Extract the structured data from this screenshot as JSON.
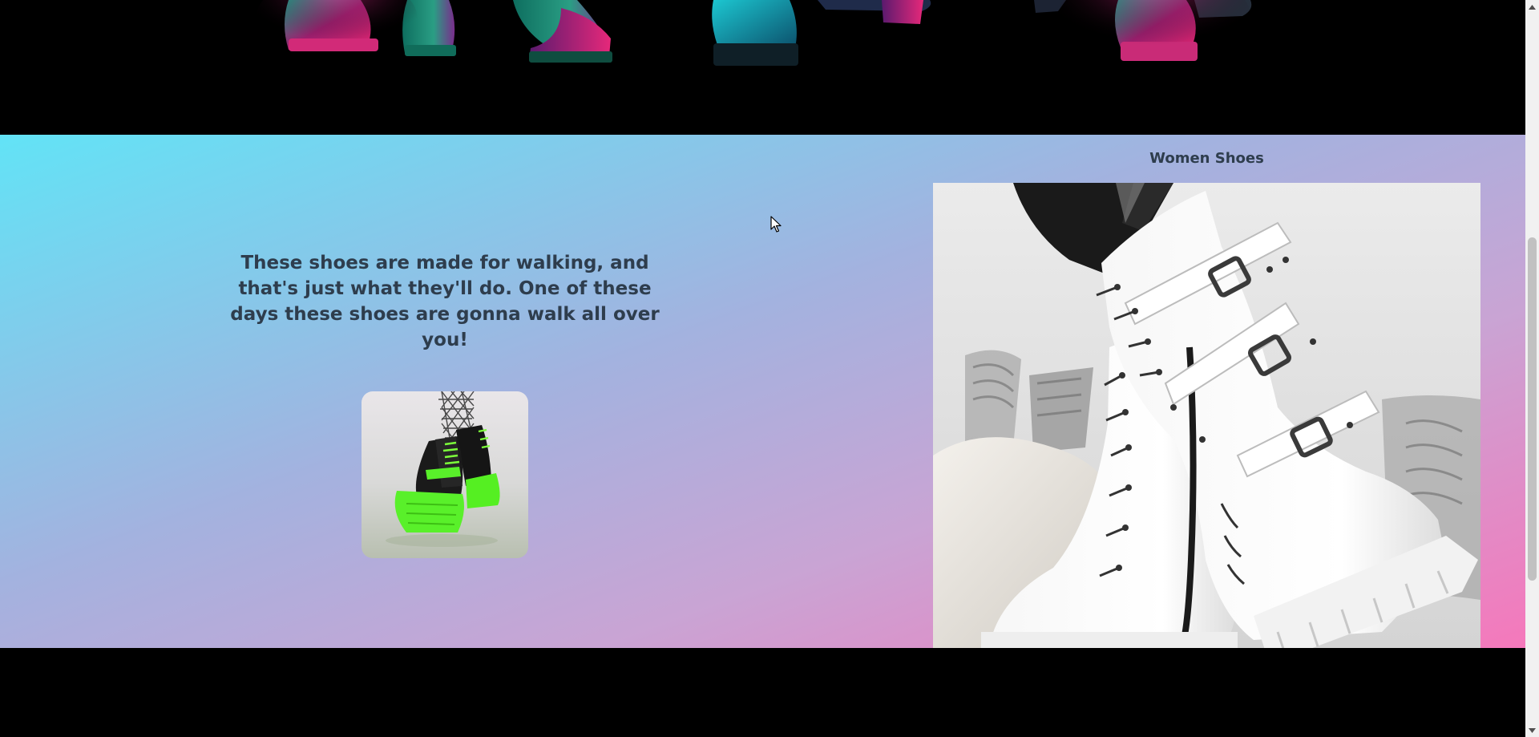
{
  "hero": {
    "image_alt": "boots lineup"
  },
  "promo": {
    "quote": "These shoes are made for walking, and that's just what they'll do. One of these days these shoes are gonna walk all over you!",
    "thumbnail_alt": "neon green platform boots"
  },
  "women": {
    "title": "Women Shoes",
    "image_alt": "white buckle boots"
  },
  "colors": {
    "gradient_start": "#62e3f6",
    "gradient_end": "#f578bb",
    "heading_text": "#2e3d4d",
    "page_background": "#000000"
  },
  "icons": {
    "scroll_up": "chevron-up-icon",
    "scroll_down": "chevron-down-icon",
    "cursor": "pointer-cursor-icon"
  }
}
